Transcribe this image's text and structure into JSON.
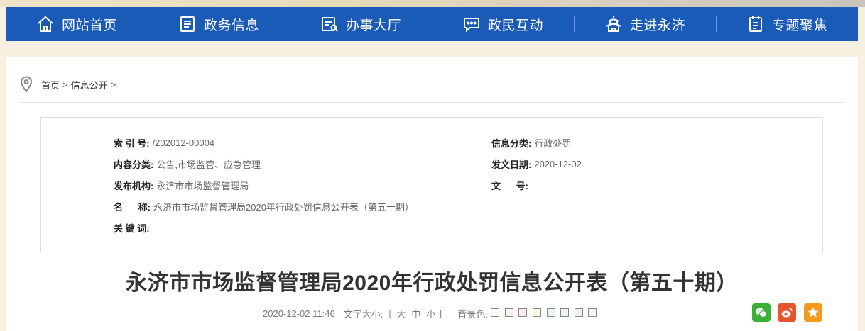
{
  "nav": {
    "items": [
      {
        "label": "网站首页",
        "icon": "home-icon"
      },
      {
        "label": "政务信息",
        "icon": "document-list-icon"
      },
      {
        "label": "办事大厅",
        "icon": "service-hall-icon"
      },
      {
        "label": "政民互动",
        "icon": "chat-bubble-icon"
      },
      {
        "label": "走进永济",
        "icon": "pagoda-icon"
      },
      {
        "label": "专题聚焦",
        "icon": "notepad-icon"
      }
    ],
    "bg_color": "#1a5bb8"
  },
  "breadcrumb": {
    "items": [
      "首页",
      "信息公开"
    ],
    "separator": ">"
  },
  "meta": {
    "index_no": {
      "key": "索 引 号:",
      "value": "/202012-00004"
    },
    "category": {
      "key": "信息分类:",
      "value": "行政处罚"
    },
    "content_type": {
      "key": "内容分类:",
      "value": "公告,市场监管、应急管理"
    },
    "issue_date": {
      "key": "发文日期:",
      "value": "2020-12-02"
    },
    "publisher": {
      "key": "发布机构:",
      "value": "永济市市场监督管理局"
    },
    "doc_no": {
      "key": "文      号:",
      "value": ""
    },
    "name": {
      "key": "名      称:",
      "value": "永济市市场监督管理局2020年行政处罚信息公开表（第五十期）"
    },
    "keywords": {
      "key": "关 键 词:",
      "value": ""
    }
  },
  "document": {
    "title": "永济市市场监督管理局2020年行政处罚信息公开表（第五十期）",
    "datetime": "2020-12-02 11:46",
    "font_size_label": "文字大小:［",
    "font_size_end": "］",
    "font_sizes": [
      "大",
      "中",
      "小"
    ],
    "bg_label": "背景色:",
    "bg_colors": [
      "#ffffff",
      "#faf5ea",
      "#fbeaea",
      "#fff9e6",
      "#eafaf0",
      "#e8f2fb",
      "#eeeeee",
      "#f6f6f6"
    ]
  },
  "share": [
    {
      "icon": "wechat-icon",
      "color": "#3cb034"
    },
    {
      "icon": "weibo-icon",
      "color": "#e8542d"
    },
    {
      "icon": "favorite-star-icon",
      "color": "#f29b1d"
    }
  ]
}
